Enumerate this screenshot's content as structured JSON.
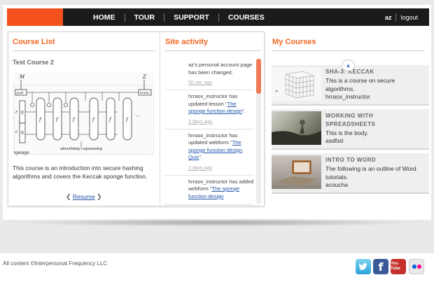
{
  "nav": {
    "items": [
      "HOME",
      "TOUR",
      "SUPPORT",
      "COURSES"
    ],
    "user": "az",
    "logout": "logout"
  },
  "course_list": {
    "title": "Course List",
    "course_name": "Test Course 2",
    "description": "This course is an introduction into secure hashing algorithms and covers the Keccak sponge function.",
    "resume": "Resume",
    "diagram_labels": {
      "m": "M",
      "z": "Z",
      "pad": "pad",
      "trunc": "trunc",
      "r": "r",
      "c": "c",
      "zero1": "0",
      "zero2": "0",
      "f": "f",
      "absorbing": "absorbing",
      "squeezing": "squeezing",
      "sponge": "sponge",
      "dots": "..."
    }
  },
  "activity": {
    "title": "Site activity",
    "items": [
      {
        "text": "az's personal account page has been changed.",
        "link": "",
        "after": "",
        "time": "50 sec ago"
      },
      {
        "text": "hrraox_instructor has updated lesson \"",
        "link": "The sponge function design",
        "after": "\".",
        "time": "2 days ago"
      },
      {
        "text": "hrraox_instructor has updated webform \"",
        "link": "The sponge function design Quiz",
        "after": "\".",
        "time": "2 days ago"
      },
      {
        "text": "hrraox_instructor has added webform \"",
        "link": "The sponge function design",
        "after": "",
        "time": ""
      }
    ]
  },
  "my_courses": {
    "title": "My Courses",
    "items": [
      {
        "title": "SHA-3: KECCAK",
        "description": "This is a course on secure algorithms.",
        "author": "hrraox_instructor"
      },
      {
        "title": "WORKING WITH SPREADSHEETS",
        "description": "This is the body.",
        "author": "asdfsd"
      },
      {
        "title": "INTRO TO WORD",
        "description": "The following is an outline of Word tutorials.",
        "author": "acoucha"
      }
    ]
  },
  "footer": {
    "copyright": "All content ©Interpersonal Frequency LLC",
    "social": [
      "twitter-icon",
      "facebook-icon",
      "youtube-icon",
      "flickr-icon"
    ],
    "youtube_label": "You Tube"
  },
  "colors": {
    "accent": "#f26522",
    "nav_bg": "#1b1b1b",
    "link": "#2255aa"
  }
}
